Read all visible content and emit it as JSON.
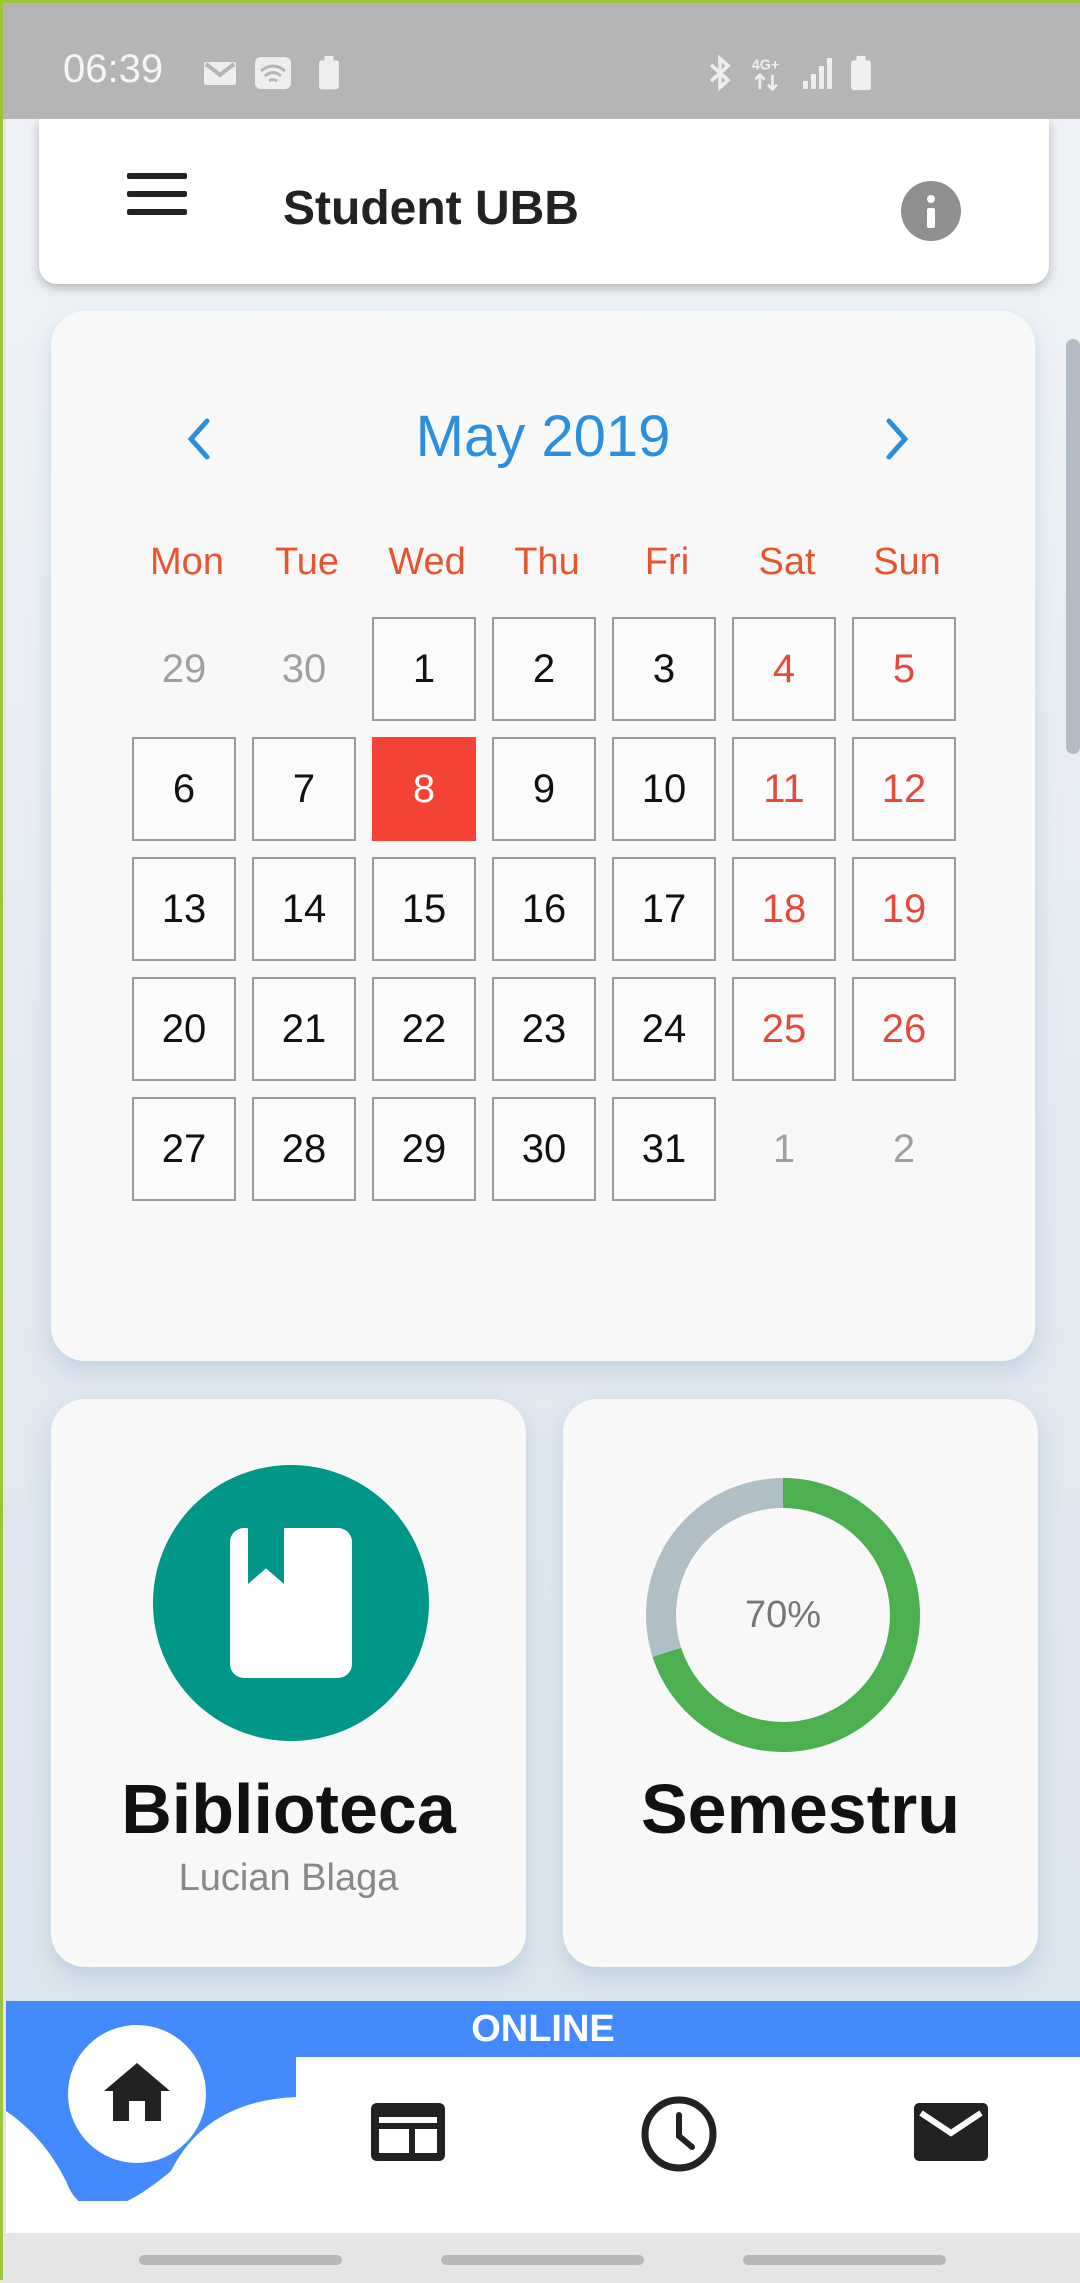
{
  "status_bar": {
    "time": "06:39",
    "icons": [
      "gmail-icon",
      "wifi-icon",
      "battery-saver-icon",
      "bluetooth-icon",
      "4g-icon",
      "signal-icon",
      "battery-icon"
    ]
  },
  "app_bar": {
    "title": "Student UBB",
    "menu_icon": "menu-icon",
    "info_icon": "info-icon"
  },
  "calendar": {
    "month_label": "May 2019",
    "weekdays": [
      "Mon",
      "Tue",
      "Wed",
      "Thu",
      "Fri",
      "Sat",
      "Sun"
    ],
    "weeks": [
      [
        {
          "d": "29",
          "t": "out"
        },
        {
          "d": "30",
          "t": "out"
        },
        {
          "d": "1",
          "t": "day"
        },
        {
          "d": "2",
          "t": "day"
        },
        {
          "d": "3",
          "t": "day"
        },
        {
          "d": "4",
          "t": "wknd"
        },
        {
          "d": "5",
          "t": "wknd"
        }
      ],
      [
        {
          "d": "6",
          "t": "day"
        },
        {
          "d": "7",
          "t": "day"
        },
        {
          "d": "8",
          "t": "today"
        },
        {
          "d": "9",
          "t": "day"
        },
        {
          "d": "10",
          "t": "day"
        },
        {
          "d": "11",
          "t": "wknd"
        },
        {
          "d": "12",
          "t": "wknd"
        }
      ],
      [
        {
          "d": "13",
          "t": "day"
        },
        {
          "d": "14",
          "t": "day"
        },
        {
          "d": "15",
          "t": "day"
        },
        {
          "d": "16",
          "t": "day"
        },
        {
          "d": "17",
          "t": "day"
        },
        {
          "d": "18",
          "t": "wknd"
        },
        {
          "d": "19",
          "t": "wknd"
        }
      ],
      [
        {
          "d": "20",
          "t": "day"
        },
        {
          "d": "21",
          "t": "day"
        },
        {
          "d": "22",
          "t": "day"
        },
        {
          "d": "23",
          "t": "day"
        },
        {
          "d": "24",
          "t": "day"
        },
        {
          "d": "25",
          "t": "wknd"
        },
        {
          "d": "26",
          "t": "wknd"
        }
      ],
      [
        {
          "d": "27",
          "t": "day"
        },
        {
          "d": "28",
          "t": "day"
        },
        {
          "d": "29",
          "t": "day"
        },
        {
          "d": "30",
          "t": "day"
        },
        {
          "d": "31",
          "t": "day"
        },
        {
          "d": "1",
          "t": "out"
        },
        {
          "d": "2",
          "t": "out"
        }
      ]
    ]
  },
  "library_card": {
    "title": "Biblioteca",
    "subtitle": "Lucian Blaga",
    "icon": "book-icon",
    "color": "#009688"
  },
  "semester_card": {
    "title": "Semestru",
    "progress_label": "70%",
    "progress": 0.7,
    "progress_color": "#4caf50",
    "track_color": "#b0bec5"
  },
  "bottom_nav": {
    "status_label": "ONLINE",
    "status_color": "#448aff",
    "items": [
      "home-icon",
      "news-icon",
      "clock-icon",
      "mail-icon"
    ]
  }
}
